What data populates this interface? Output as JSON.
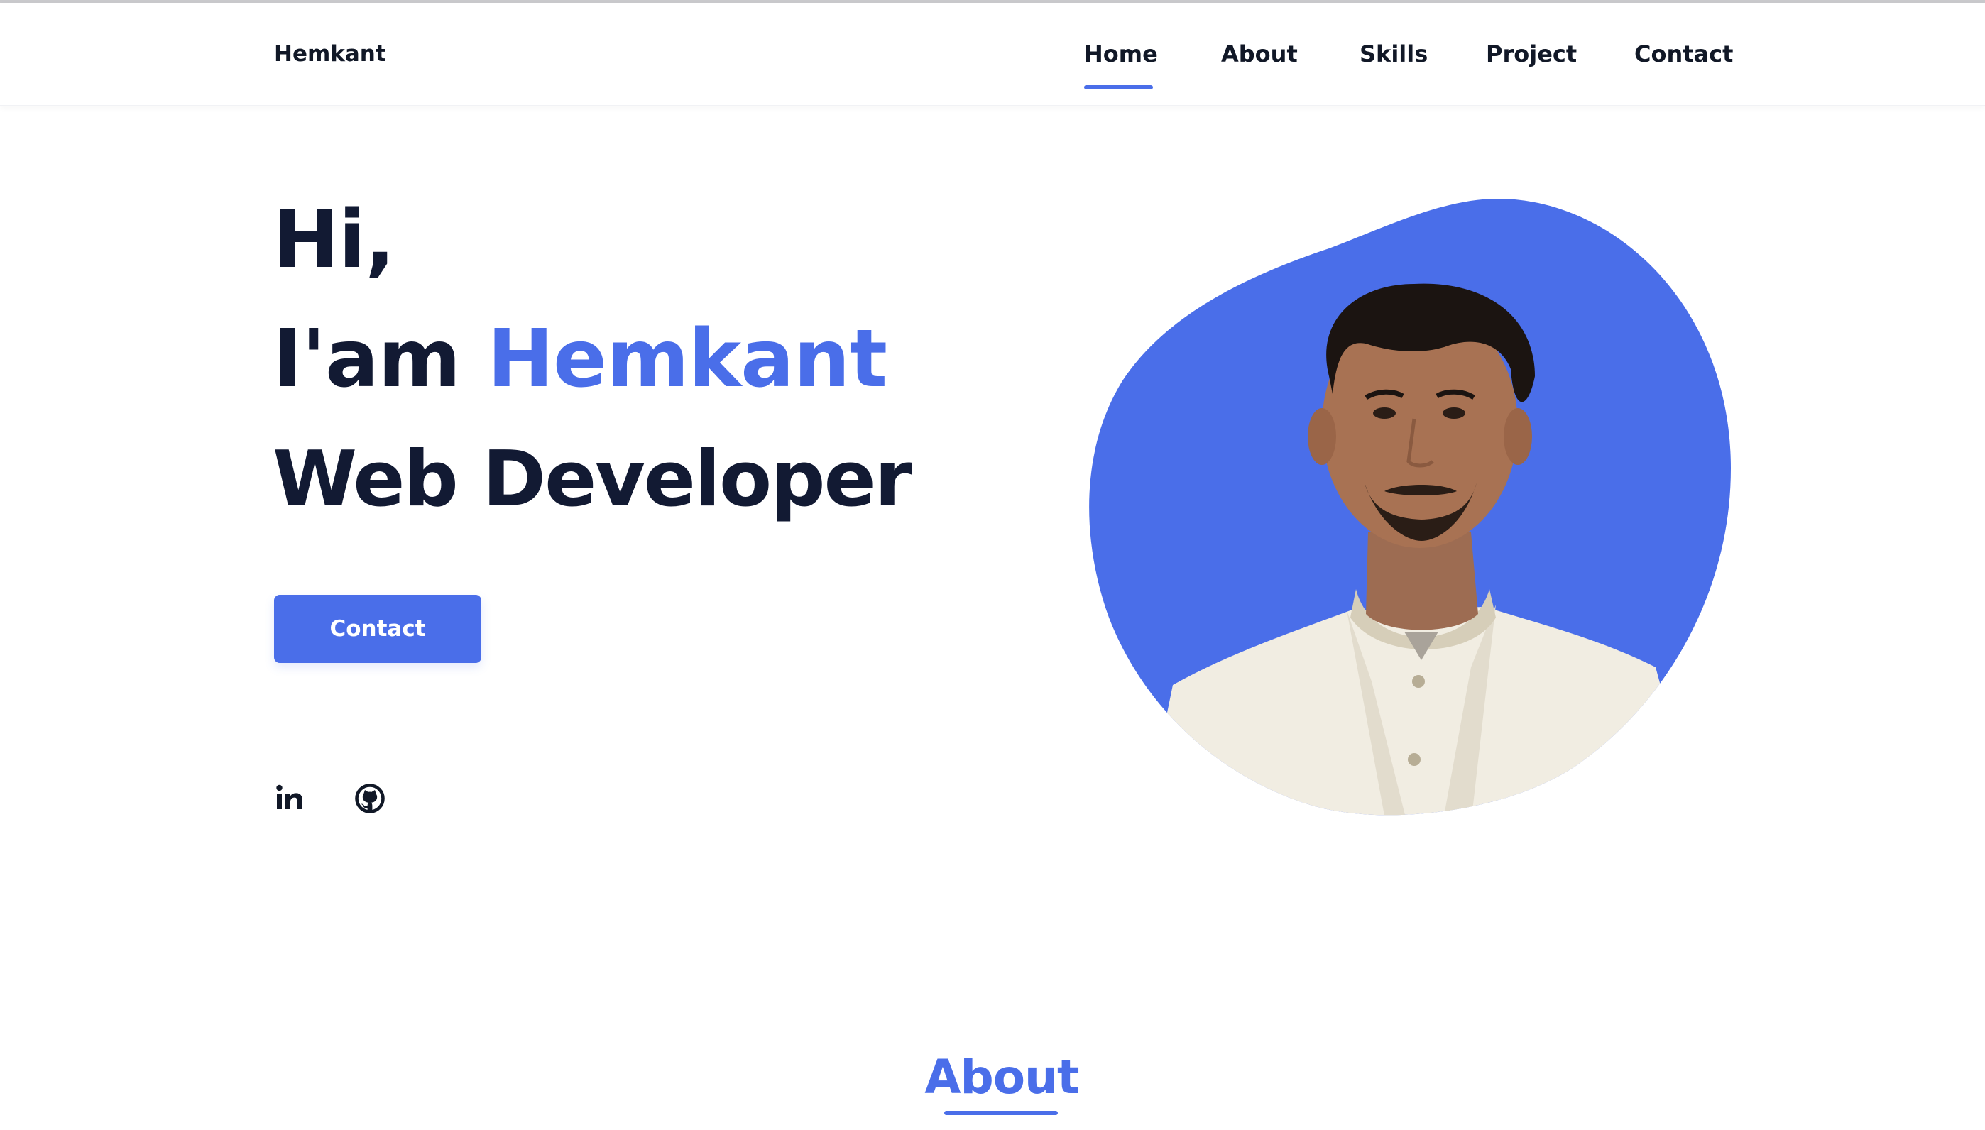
{
  "nav": {
    "brand": "Hemkant",
    "items": [
      {
        "label": "Home",
        "active": true
      },
      {
        "label": "About",
        "active": false
      },
      {
        "label": "Skills",
        "active": false
      },
      {
        "label": "Project",
        "active": false
      },
      {
        "label": "Contact",
        "active": false
      }
    ]
  },
  "hero": {
    "greeting": "Hi,",
    "intro": "I'am",
    "name": "Hemkant",
    "role": "Web Developer",
    "cta_label": "Contact"
  },
  "social": {
    "icons": [
      "linkedin-icon",
      "github-icon"
    ]
  },
  "about": {
    "title": "About"
  },
  "colors": {
    "accent": "#4a6ee9",
    "heading": "#121a33",
    "background": "#ffffff"
  }
}
